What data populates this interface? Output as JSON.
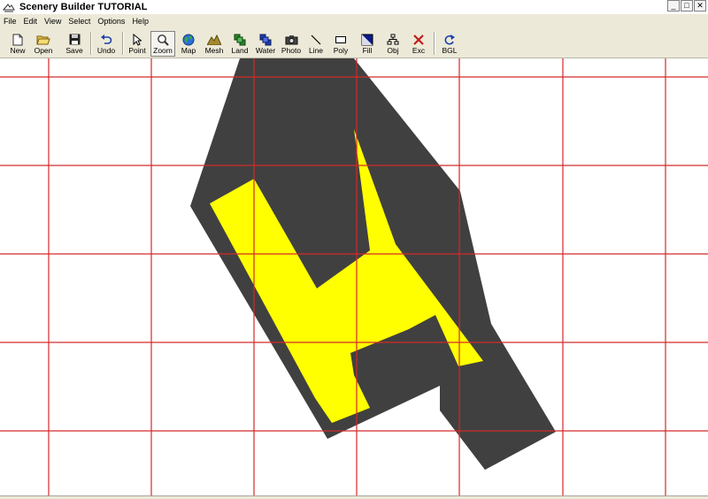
{
  "window": {
    "title": "Scenery Builder  TUTORIAL",
    "controls": {
      "minimize": "_",
      "maximize": "□",
      "close": "✕"
    }
  },
  "menu": {
    "items": [
      {
        "label": "File"
      },
      {
        "label": "Edit"
      },
      {
        "label": "View"
      },
      {
        "label": "Select"
      },
      {
        "label": "Options"
      },
      {
        "label": "Help"
      }
    ]
  },
  "toolbar": {
    "buttons": [
      {
        "key": "new",
        "label": "New",
        "icon": "new-file-icon"
      },
      {
        "key": "open",
        "label": "Open",
        "icon": "open-folder-icon"
      },
      {
        "key": "save",
        "label": "Save",
        "icon": "floppy-disk-icon"
      },
      {
        "key": "undo",
        "label": "Undo",
        "icon": "undo-arrow-icon"
      },
      {
        "key": "point",
        "label": "Point",
        "icon": "pointer-arrow-icon"
      },
      {
        "key": "zoom",
        "label": "Zoom",
        "icon": "magnifier-icon",
        "pressed": true
      },
      {
        "key": "map",
        "label": "Map",
        "icon": "globe-icon"
      },
      {
        "key": "mesh",
        "label": "Mesh",
        "icon": "mountain-icon"
      },
      {
        "key": "land",
        "label": "Land",
        "icon": "land-tiles-icon"
      },
      {
        "key": "water",
        "label": "Water",
        "icon": "water-tiles-icon"
      },
      {
        "key": "photo",
        "label": "Photo",
        "icon": "camera-icon"
      },
      {
        "key": "line",
        "label": "Line",
        "icon": "line-tool-icon"
      },
      {
        "key": "poly",
        "label": "Poly",
        "icon": "rectangle-tool-icon"
      },
      {
        "key": "fill",
        "label": "Fill",
        "icon": "fill-tool-icon"
      },
      {
        "key": "obj",
        "label": "Obj",
        "icon": "object-tree-icon"
      },
      {
        "key": "exc",
        "label": "Exc",
        "icon": "exclusion-x-icon"
      },
      {
        "key": "bgl",
        "label": "BGL",
        "icon": "compile-bgl-icon"
      }
    ]
  },
  "canvas": {
    "colors": {
      "background": "#ffffff",
      "grid": "#d42a2a",
      "dark_polygon": "#404040",
      "yellow_polygon": "#ffff00"
    }
  }
}
